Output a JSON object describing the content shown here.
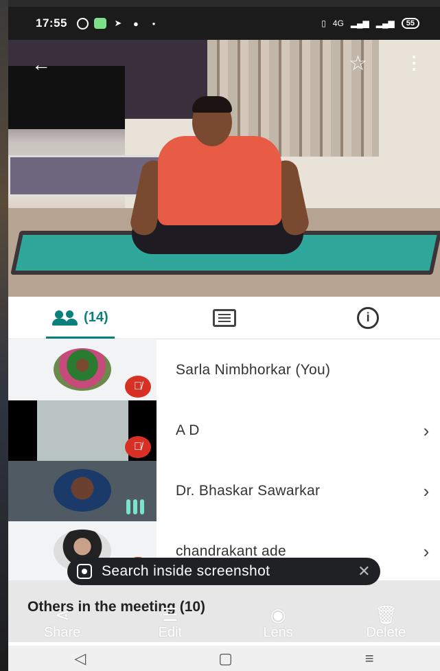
{
  "status_bar": {
    "time": "17:55",
    "network": "4G",
    "battery": "55"
  },
  "call": {
    "participants_count": "(14)"
  },
  "participants": [
    {
      "name": "Sarla Nimbhorkar (You)",
      "muted": true,
      "has_chevron": false
    },
    {
      "name": "A D",
      "muted": true,
      "has_chevron": true
    },
    {
      "name": "Dr. Bhaskar Sawarkar",
      "muted": false,
      "speaking": true,
      "has_chevron": true
    },
    {
      "name": "chandrakant ade",
      "muted": true,
      "has_chevron": true
    }
  ],
  "others_section": "Others in the meeting (10)",
  "search_chip": "Search inside screenshot",
  "actions": {
    "share": "Share",
    "edit": "Edit",
    "lens": "Lens",
    "delete": "Delete"
  },
  "colors": {
    "accent": "#0b7f7a",
    "mute_red": "#d93025",
    "speaking_green": "#7be3c9"
  }
}
